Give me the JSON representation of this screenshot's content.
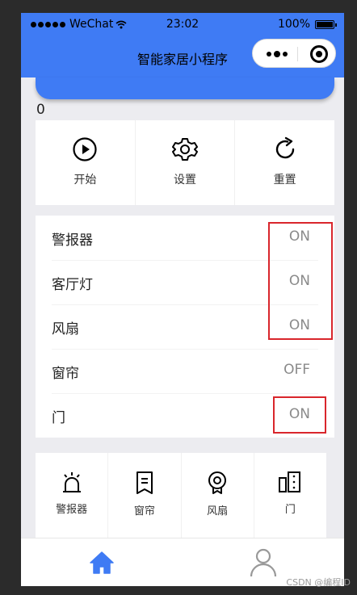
{
  "status_bar": {
    "carrier": "WeChat",
    "time": "23:02",
    "battery": "100%"
  },
  "nav": {
    "title": "智能家居小程序"
  },
  "counter": "0",
  "operations": [
    {
      "label": "开始",
      "icon": "play-icon"
    },
    {
      "label": "设置",
      "icon": "gear-icon"
    },
    {
      "label": "重置",
      "icon": "refresh-icon"
    }
  ],
  "device_status": [
    {
      "name": "警报器",
      "state": "ON"
    },
    {
      "name": "客厅灯",
      "state": "ON"
    },
    {
      "name": "风扇",
      "state": "ON"
    },
    {
      "name": "窗帘",
      "state": "OFF"
    },
    {
      "name": "门",
      "state": "ON"
    }
  ],
  "device_buttons": [
    {
      "label": "警报器",
      "icon": "alarm-icon"
    },
    {
      "label": "窗帘",
      "icon": "curtain-icon"
    },
    {
      "label": "风扇",
      "icon": "fan-icon"
    },
    {
      "label": "门",
      "icon": "door-icon"
    }
  ],
  "tabbar": [
    {
      "icon": "home-icon",
      "active": true
    },
    {
      "icon": "user-icon",
      "active": false
    }
  ],
  "colors": {
    "primary": "#3f7bf4",
    "highlight": "#d9262c"
  },
  "watermark": "CSDN @编程ID"
}
